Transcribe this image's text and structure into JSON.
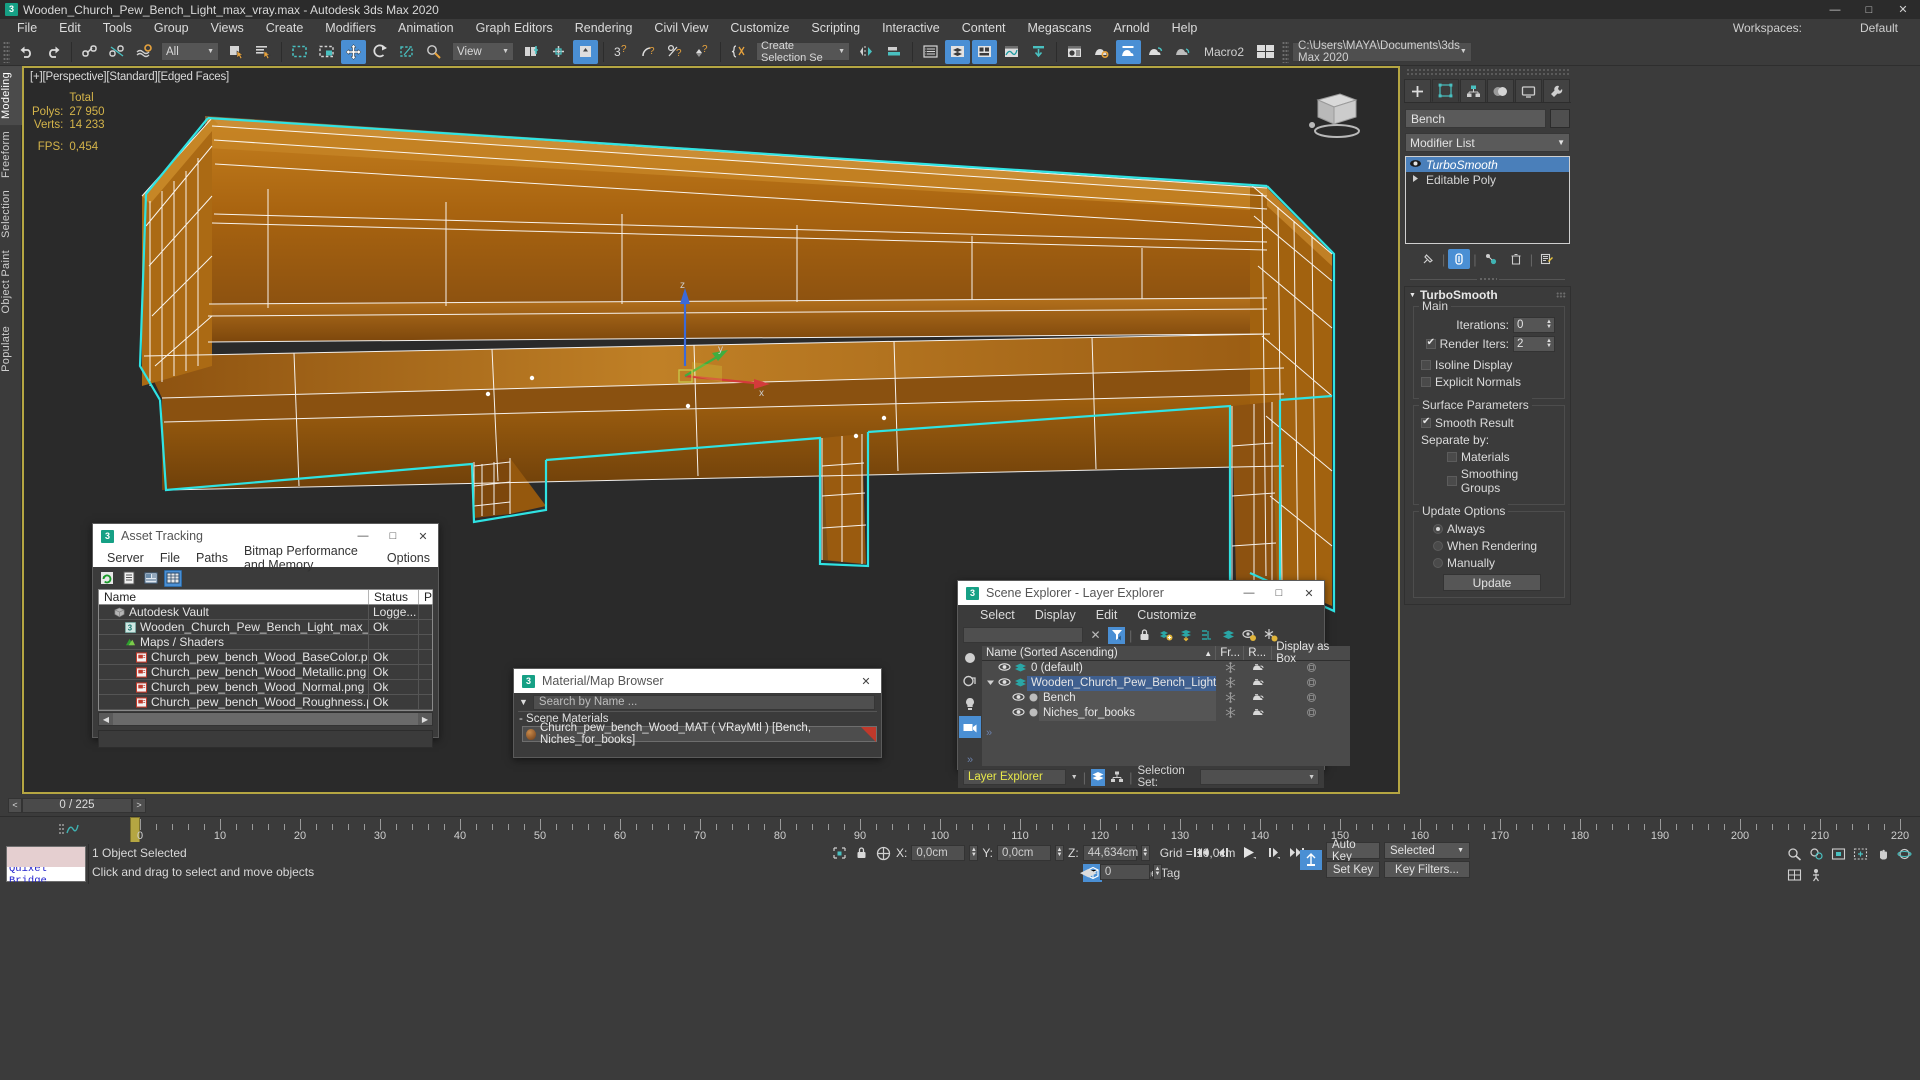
{
  "window": {
    "title": "Wooden_Church_Pew_Bench_Light_max_vray.max - Autodesk 3ds Max 2020",
    "app_icon": "3",
    "minimize": "—",
    "maximize": "□",
    "close": "✕"
  },
  "menubar": {
    "items": [
      "File",
      "Edit",
      "Tools",
      "Group",
      "Views",
      "Create",
      "Modifiers",
      "Animation",
      "Graph Editors",
      "Rendering",
      "Civil View",
      "Customize",
      "Scripting",
      "Interactive",
      "Content",
      "Megascans",
      "Arnold",
      "Help"
    ],
    "workspaces_label": "Workspaces:",
    "workspaces_value": "Default"
  },
  "toolbar": {
    "selection_filter": "All",
    "reference_coord": "View",
    "named_selection_sets": "Create Selection Se",
    "macro_label": "Macro2",
    "project_path": "C:\\Users\\MAYA\\Documents\\3ds Max 2020"
  },
  "ribbon_tabs": [
    "Modeling",
    "Freeform",
    "Selection",
    "Object Paint",
    "Populate"
  ],
  "viewport": {
    "label": "[+][Perspective][Standard][Edged Faces]",
    "stats": {
      "header": "Total",
      "polys_label": "Polys:",
      "polys_value": "27 950",
      "verts_label": "Verts:",
      "verts_value": "14 233",
      "fps_label": "FPS:",
      "fps_value": "0,454"
    }
  },
  "command_panel": {
    "object_name": "Bench",
    "modifier_list_label": "Modifier List",
    "modifiers": [
      {
        "label": "TurboSmooth",
        "selected": true
      },
      {
        "label": "Editable Poly",
        "selected": false
      }
    ],
    "rollout": {
      "title": "TurboSmooth",
      "main_group": "Main",
      "iterations_label": "Iterations:",
      "iterations_value": "0",
      "render_iters_label": "Render Iters:",
      "render_iters_value": "2",
      "render_iters_checked": true,
      "isoline_display": "Isoline Display",
      "explicit_normals": "Explicit Normals",
      "surface_group": "Surface Parameters",
      "smooth_result": "Smooth Result",
      "separate_by": "Separate by:",
      "materials": "Materials",
      "smoothing_groups": "Smoothing Groups",
      "update_group": "Update Options",
      "always": "Always",
      "when_rendering": "When Rendering",
      "manually": "Manually",
      "update_button": "Update"
    }
  },
  "asset_tracking": {
    "title": "Asset Tracking",
    "menu": [
      "Server",
      "File",
      "Paths",
      "Bitmap Performance and Memory",
      "Options"
    ],
    "columns": [
      "Name",
      "Status",
      "P"
    ],
    "rows": [
      {
        "name": "Autodesk Vault",
        "status": "Logge...",
        "indent": 1,
        "icon": "vault-icon"
      },
      {
        "name": "Wooden_Church_Pew_Bench_Light_max_vray.max",
        "status": "Ok",
        "indent": 2,
        "icon": "max-file-icon"
      },
      {
        "name": "Maps / Shaders",
        "status": "",
        "indent": 2,
        "icon": "maps-icon"
      },
      {
        "name": "Church_pew_bench_Wood_BaseColor.png",
        "status": "Ok",
        "indent": 3,
        "icon": "bitmap-icon"
      },
      {
        "name": "Church_pew_bench_Wood_Metallic.png",
        "status": "Ok",
        "indent": 3,
        "icon": "bitmap-icon"
      },
      {
        "name": "Church_pew_bench_Wood_Normal.png",
        "status": "Ok",
        "indent": 3,
        "icon": "bitmap-icon"
      },
      {
        "name": "Church_pew_bench_Wood_Roughness.png",
        "status": "Ok",
        "indent": 3,
        "icon": "bitmap-icon"
      }
    ]
  },
  "material_browser": {
    "title": "Material/Map Browser",
    "search_placeholder": "Search by Name ...",
    "section": "- Scene Materials",
    "material": "Church_pew_bench_Wood_MAT ( VRayMtl ) [Bench, Niches_for_books]"
  },
  "scene_explorer": {
    "title": "Scene Explorer - Layer Explorer",
    "menu": [
      "Select",
      "Display",
      "Edit",
      "Customize"
    ],
    "columns": [
      "Name (Sorted Ascending)",
      "Fr...",
      "R...",
      "Display as Box"
    ],
    "rows": [
      {
        "name": "0 (default)",
        "indent": 1,
        "type": "layer",
        "selected": false
      },
      {
        "name": "Wooden_Church_Pew_Bench_Light",
        "indent": 1,
        "type": "layer",
        "selected": true,
        "expanded": true
      },
      {
        "name": "Bench",
        "indent": 2,
        "type": "object",
        "selected": false
      },
      {
        "name": "Niches_for_books",
        "indent": 2,
        "type": "object",
        "selected": false
      }
    ],
    "explorer_name": "Layer Explorer",
    "selection_set_label": "Selection Set:",
    "selection_set_value": ""
  },
  "timeline": {
    "frame_field": "0 / 225",
    "prev": "<",
    "next": ">",
    "ticks": [
      0,
      10,
      20,
      30,
      40,
      50,
      60,
      70,
      80,
      90,
      100,
      110,
      120,
      130,
      140,
      150,
      160,
      170,
      180,
      190,
      200,
      210,
      220
    ]
  },
  "statusbar": {
    "quixel_label": "Quixel Bridge",
    "message_selected": "1 Object Selected",
    "message_hint": "Click and drag to select and move objects",
    "x_label": "X:",
    "x_value": "0,0cm",
    "y_label": "Y:",
    "y_value": "0,0cm",
    "z_label": "Z:",
    "z_value": "44,634cm",
    "grid_label": "Grid = 10,0cm",
    "add_time_tag": "Add Time Tag",
    "auto_key": "Auto Key",
    "set_key": "Set Key",
    "key_filters": "Key Filters...",
    "selected_combo": "Selected",
    "key_spinner": "0"
  },
  "colors": {
    "accent_blue": "#4a8fd4",
    "teal": "#2aa198",
    "gold": "#b5a642",
    "wood": "#b5701f",
    "selection_cyan": "#2fe3e3"
  }
}
